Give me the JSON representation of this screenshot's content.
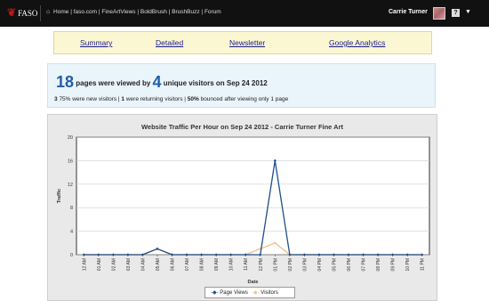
{
  "topbar": {
    "logo_text": "FASO",
    "nav_items": [
      "Home",
      "faso.com",
      "FineArtViews",
      "BoldBrush",
      "BrushBuzz",
      "Forum"
    ],
    "user_name": "Carrie Turner",
    "help_label": "?",
    "menu_label": "▼"
  },
  "tabs": [
    "Summary",
    "Detailed",
    "Newsletter",
    "Google Analytics"
  ],
  "stats": {
    "pages_count": "18",
    "pages_text": "pages were viewed by",
    "visitors_count": "4",
    "visitors_text": "unique visitors on Sep 24 2012",
    "new_count": "3",
    "new_text": "75% were new visitors",
    "returning_count": "1",
    "returning_text": "were returning visitors",
    "bounce_pct": "50%",
    "bounce_text": "bounced after viewing only 1 page"
  },
  "chart_data": {
    "type": "line",
    "title": "Website Traffic Per Hour on Sep 24 2012 - Carrie Turner Fine Art",
    "xlabel": "Date",
    "ylabel": "Traffic",
    "ylim": [
      0,
      20
    ],
    "yticks": [
      0,
      4,
      8,
      12,
      16,
      20
    ],
    "grid": true,
    "legend_position": "bottom-center",
    "categories": [
      "12 AM",
      "01 AM",
      "02 AM",
      "03 AM",
      "04 AM",
      "05 AM",
      "06 AM",
      "07 AM",
      "08 AM",
      "09 AM",
      "10 AM",
      "11 AM",
      "12 PM",
      "01 PM",
      "02 PM",
      "03 PM",
      "04 PM",
      "05 PM",
      "06 PM",
      "07 PM",
      "08 PM",
      "09 PM",
      "10 PM",
      "11 PM"
    ],
    "series": [
      {
        "name": "Page Views",
        "color": "#1f4e8c",
        "values": [
          0,
          0,
          0,
          0,
          0,
          1,
          0,
          0,
          0,
          0,
          0,
          0,
          0,
          16,
          0,
          0,
          0,
          0,
          0,
          0,
          0,
          0,
          0,
          0
        ]
      },
      {
        "name": "Visitors",
        "color": "#f0c590",
        "values": [
          0,
          0,
          0,
          0,
          0,
          1,
          0,
          0,
          0,
          0,
          0,
          0,
          1,
          2,
          0,
          0,
          0,
          0,
          0,
          0,
          0,
          0,
          0,
          0
        ]
      }
    ]
  }
}
